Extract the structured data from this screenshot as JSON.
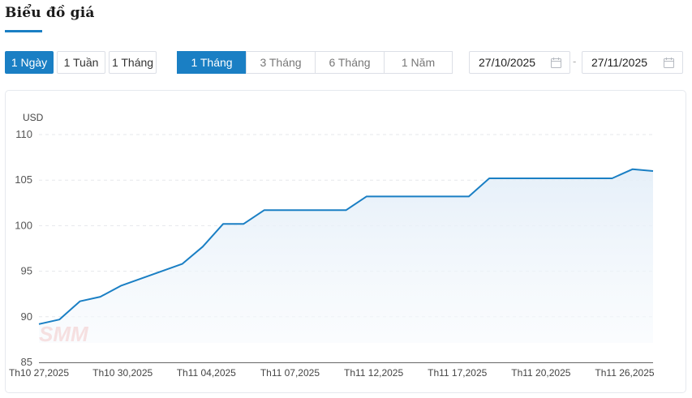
{
  "header": {
    "title": "Biểu đồ giá"
  },
  "interval_tabs": [
    {
      "label": "1 Ngày",
      "active": true
    },
    {
      "label": "1 Tuần",
      "active": false
    },
    {
      "label": "1 Tháng",
      "active": false
    }
  ],
  "range_tabs": [
    {
      "label": "1 Tháng",
      "active": true
    },
    {
      "label": "3 Tháng",
      "active": false
    },
    {
      "label": "6 Tháng",
      "active": false
    },
    {
      "label": "1 Năm",
      "active": false
    }
  ],
  "date_range": {
    "start": "27/10/2025",
    "separator": "-",
    "end": "27/11/2025",
    "icon": "calendar-icon"
  },
  "watermark": "SMM",
  "colors": {
    "accent": "#1a7fc4",
    "line": "#1a7fc4",
    "area_fill": "#eaf3fb",
    "grid": "#e5e7eb"
  },
  "chart_data": {
    "type": "area",
    "ylabel": "USD",
    "ylim": [
      85,
      110
    ],
    "yticks": [
      85,
      90,
      95,
      100,
      105,
      110
    ],
    "x_tick_labels": [
      "Th10 27,2025",
      "Th10 30,2025",
      "Th11 04,2025",
      "Th11 07,2025",
      "Th11 12,2025",
      "Th11 17,2025",
      "Th11 20,2025",
      "Th11 26,2025"
    ],
    "x": [
      "2025-10-27",
      "2025-10-28",
      "2025-10-29",
      "2025-10-30",
      "2025-10-31",
      "2025-11-03",
      "2025-11-04",
      "2025-11-05",
      "2025-11-06",
      "2025-11-07",
      "2025-11-10",
      "2025-11-11",
      "2025-11-12",
      "2025-11-13",
      "2025-11-14",
      "2025-11-17",
      "2025-11-18",
      "2025-11-19",
      "2025-11-20",
      "2025-11-21",
      "2025-11-24",
      "2025-11-25",
      "2025-11-26"
    ],
    "values": [
      89.2,
      89.7,
      91.7,
      92.2,
      93.4,
      95.8,
      97.7,
      100.2,
      100.2,
      101.7,
      101.7,
      101.7,
      103.2,
      103.2,
      103.2,
      103.2,
      105.2,
      105.2,
      105.2,
      105.2,
      105.2,
      106.2,
      106.0
    ],
    "grid": true,
    "legend": "none"
  }
}
